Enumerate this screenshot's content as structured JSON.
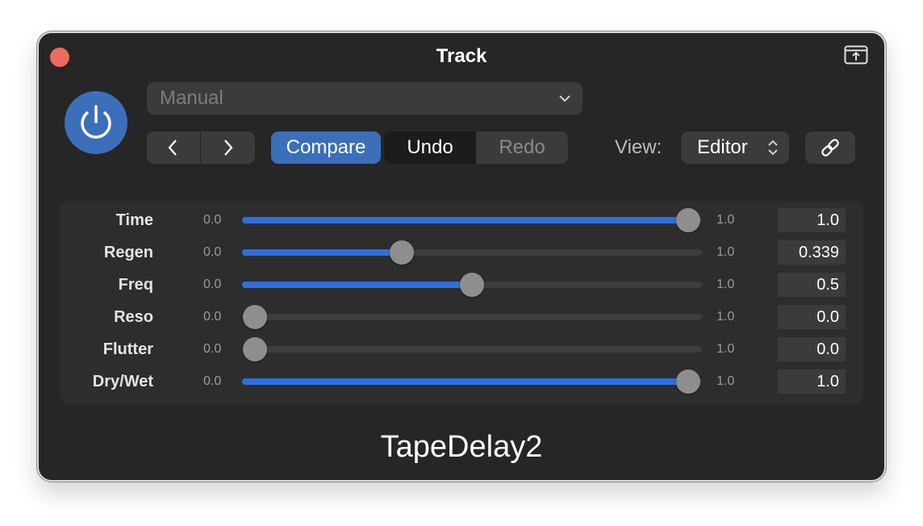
{
  "window": {
    "title": "Track"
  },
  "preset": {
    "value": "Manual"
  },
  "toolbar": {
    "compare_label": "Compare",
    "undo_label": "Undo",
    "redo_label": "Redo",
    "view_label": "View:",
    "view_value": "Editor"
  },
  "colors": {
    "accent": "#3c6fba",
    "slider_fill": "#2f6fe0",
    "background": "#262626",
    "close": "#ed6a5e"
  },
  "icons": {
    "close": "close-icon",
    "shrink": "shrink-window-icon",
    "power": "power-icon",
    "preset_dropdown": "chevron-down-icon",
    "prev": "chevron-left-icon",
    "next": "chevron-right-icon",
    "view_select": "chevron-updown-icon",
    "link": "link-icon"
  },
  "params": [
    {
      "name": "Time",
      "min": "0.0",
      "max": "1.0",
      "value": "1.0",
      "level": 1.0
    },
    {
      "name": "Regen",
      "min": "0.0",
      "max": "1.0",
      "value": "0.339",
      "level": 0.339
    },
    {
      "name": "Freq",
      "min": "0.0",
      "max": "1.0",
      "value": "0.5",
      "level": 0.5
    },
    {
      "name": "Reso",
      "min": "0.0",
      "max": "1.0",
      "value": "0.0",
      "level": 0.0
    },
    {
      "name": "Flutter",
      "min": "0.0",
      "max": "1.0",
      "value": "0.0",
      "level": 0.0
    },
    {
      "name": "Dry/Wet",
      "min": "0.0",
      "max": "1.0",
      "value": "1.0",
      "level": 1.0
    }
  ],
  "plugin": {
    "name": "TapeDelay2"
  }
}
